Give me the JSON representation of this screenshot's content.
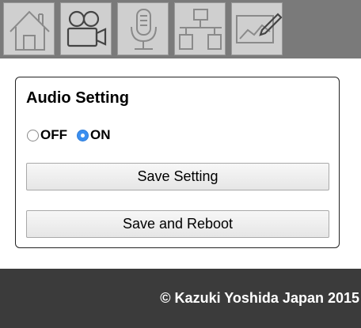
{
  "nav": {
    "tabs": [
      {
        "icon": "home-icon"
      },
      {
        "icon": "video-camera-icon"
      },
      {
        "icon": "microphone-icon"
      },
      {
        "icon": "network-icon"
      },
      {
        "icon": "image-edit-icon"
      }
    ]
  },
  "panel": {
    "title": "Audio Setting",
    "radio_off_label": "OFF",
    "radio_on_label": "ON",
    "selected": "ON",
    "save_button": "Save Setting",
    "reboot_button": "Save and Reboot"
  },
  "footer": {
    "text": "© Kazuki Yoshida Japan 2015"
  },
  "colors": {
    "navbar_bg": "#7a7a7a",
    "tab_bg": "#cfcfcf",
    "radio_selected": "#3b8ff0",
    "footer_bg": "#3b3b3b"
  }
}
